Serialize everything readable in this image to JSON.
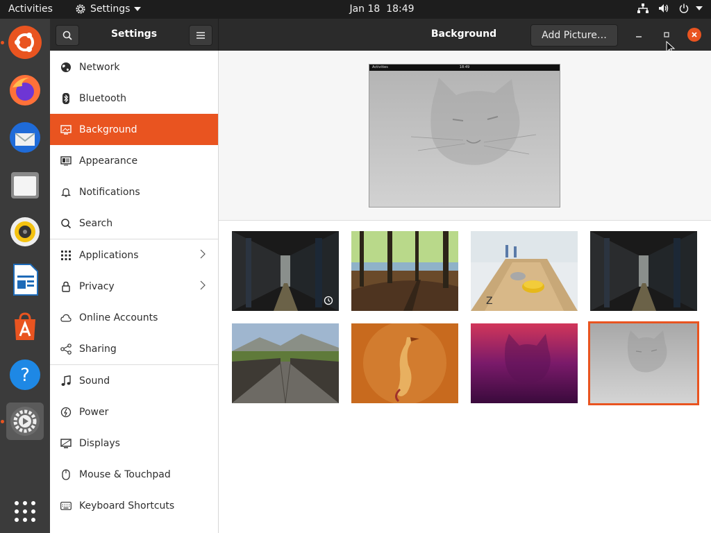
{
  "topbar": {
    "activities": "Activities",
    "app_name": "Settings",
    "date": "Jan 18",
    "time": "18:49"
  },
  "dock": {
    "items": [
      {
        "name": "ubuntu-logo-icon"
      },
      {
        "name": "firefox-icon"
      },
      {
        "name": "thunderbird-icon"
      },
      {
        "name": "files-icon"
      },
      {
        "name": "rhythmbox-icon"
      },
      {
        "name": "libreoffice-writer-icon"
      },
      {
        "name": "ubuntu-software-icon"
      },
      {
        "name": "help-icon"
      },
      {
        "name": "settings-icon"
      },
      {
        "name": "show-applications-icon"
      }
    ]
  },
  "headerbar": {
    "settings_title": "Settings",
    "page_title": "Background",
    "add_picture": "Add Picture…"
  },
  "sidebar": {
    "items": [
      {
        "label": "Network",
        "icon": "globe-icon"
      },
      {
        "label": "Bluetooth",
        "icon": "bluetooth-icon"
      },
      {
        "label": "Background",
        "icon": "monitor-icon",
        "selected": true
      },
      {
        "label": "Appearance",
        "icon": "appearance-icon"
      },
      {
        "label": "Notifications",
        "icon": "bell-icon"
      },
      {
        "label": "Search",
        "icon": "search-icon"
      },
      {
        "label": "Applications",
        "icon": "grid-icon"
      },
      {
        "label": "Privacy",
        "icon": "lock-icon"
      },
      {
        "label": "Online Accounts",
        "icon": "cloud-icon"
      },
      {
        "label": "Sharing",
        "icon": "share-icon"
      },
      {
        "label": "Sound",
        "icon": "music-note-icon"
      },
      {
        "label": "Power",
        "icon": "power-icon"
      },
      {
        "label": "Displays",
        "icon": "display-icon"
      },
      {
        "label": "Mouse & Touchpad",
        "icon": "mouse-icon"
      },
      {
        "label": "Keyboard Shortcuts",
        "icon": "keyboard-icon"
      }
    ]
  },
  "preview": {
    "mini_activities": "Activities",
    "mini_time": "18:49"
  },
  "colors": {
    "accent": "#e95420",
    "topbar": "#1d1d1d",
    "dock": "#3b3b3b",
    "headerbar": "#2b2b2b"
  }
}
